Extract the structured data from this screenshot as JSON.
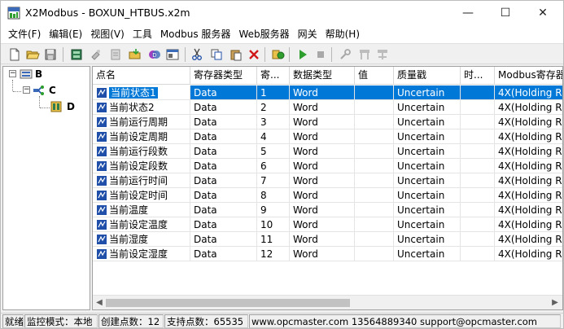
{
  "window": {
    "title": "X2Modbus - BOXUN_HTBUS.x2m",
    "minimize": "—",
    "maximize": "☐",
    "close": "✕"
  },
  "menu": [
    "文件(F)",
    "编辑(E)",
    "视图(V)",
    "工具",
    "Modbus 服务器",
    "Web服务器",
    "网关",
    "帮助(H)"
  ],
  "toolbar": {
    "icons": [
      "new-file-icon",
      "open-folder-icon",
      "save-icon",
      "device-icon",
      "new-group-icon",
      "new-tag-icon",
      "import-icon",
      "multi-tag-icon",
      "properties-icon",
      "cut-icon",
      "copy-icon",
      "paste-icon",
      "delete-icon",
      "tag-config-icon",
      "run-icon",
      "stop-icon",
      "wrench-icon",
      "gateway-a-icon",
      "gateway-b-icon"
    ]
  },
  "tree": {
    "root": "B",
    "child": "C",
    "leaf": "D"
  },
  "columns": [
    "点名",
    "寄存器类型",
    "寄...",
    "数据类型",
    "值",
    "质量戳",
    "时...",
    "Modbus寄存器"
  ],
  "rows": [
    {
      "name": "当前状态1",
      "reg_type": "Data",
      "reg": "1",
      "data_type": "Word",
      "value": "",
      "quality": "Uncertain",
      "time": "",
      "modbus": "4X(Holding R"
    },
    {
      "name": "当前状态2",
      "reg_type": "Data",
      "reg": "2",
      "data_type": "Word",
      "value": "",
      "quality": "Uncertain",
      "time": "",
      "modbus": "4X(Holding R"
    },
    {
      "name": "当前运行周期",
      "reg_type": "Data",
      "reg": "3",
      "data_type": "Word",
      "value": "",
      "quality": "Uncertain",
      "time": "",
      "modbus": "4X(Holding R"
    },
    {
      "name": "当前设定周期",
      "reg_type": "Data",
      "reg": "4",
      "data_type": "Word",
      "value": "",
      "quality": "Uncertain",
      "time": "",
      "modbus": "4X(Holding R"
    },
    {
      "name": "当前运行段数",
      "reg_type": "Data",
      "reg": "5",
      "data_type": "Word",
      "value": "",
      "quality": "Uncertain",
      "time": "",
      "modbus": "4X(Holding R"
    },
    {
      "name": "当前设定段数",
      "reg_type": "Data",
      "reg": "6",
      "data_type": "Word",
      "value": "",
      "quality": "Uncertain",
      "time": "",
      "modbus": "4X(Holding R"
    },
    {
      "name": "当前运行时间",
      "reg_type": "Data",
      "reg": "7",
      "data_type": "Word",
      "value": "",
      "quality": "Uncertain",
      "time": "",
      "modbus": "4X(Holding R"
    },
    {
      "name": "当前设定时间",
      "reg_type": "Data",
      "reg": "8",
      "data_type": "Word",
      "value": "",
      "quality": "Uncertain",
      "time": "",
      "modbus": "4X(Holding R"
    },
    {
      "name": "当前温度",
      "reg_type": "Data",
      "reg": "9",
      "data_type": "Word",
      "value": "",
      "quality": "Uncertain",
      "time": "",
      "modbus": "4X(Holding R"
    },
    {
      "name": "当前设定温度",
      "reg_type": "Data",
      "reg": "10",
      "data_type": "Word",
      "value": "",
      "quality": "Uncertain",
      "time": "",
      "modbus": "4X(Holding R"
    },
    {
      "name": "当前湿度",
      "reg_type": "Data",
      "reg": "11",
      "data_type": "Word",
      "value": "",
      "quality": "Uncertain",
      "time": "",
      "modbus": "4X(Holding R"
    },
    {
      "name": "当前设定湿度",
      "reg_type": "Data",
      "reg": "12",
      "data_type": "Word",
      "value": "",
      "quality": "Uncertain",
      "time": "",
      "modbus": "4X(Holding R"
    }
  ],
  "selected_row": 0,
  "status": {
    "ready": "就绪",
    "monitor": "监控模式：本地",
    "created": "创建点数：12",
    "supported": "支持点数：65535",
    "contact": "www.opcmaster.com 13564889340 support@opcmaster.com"
  },
  "colors": {
    "selection": "#0078d7",
    "run": "#2e9e2e",
    "delete": "#d01818",
    "tag_icon": "#1f4fa8"
  }
}
